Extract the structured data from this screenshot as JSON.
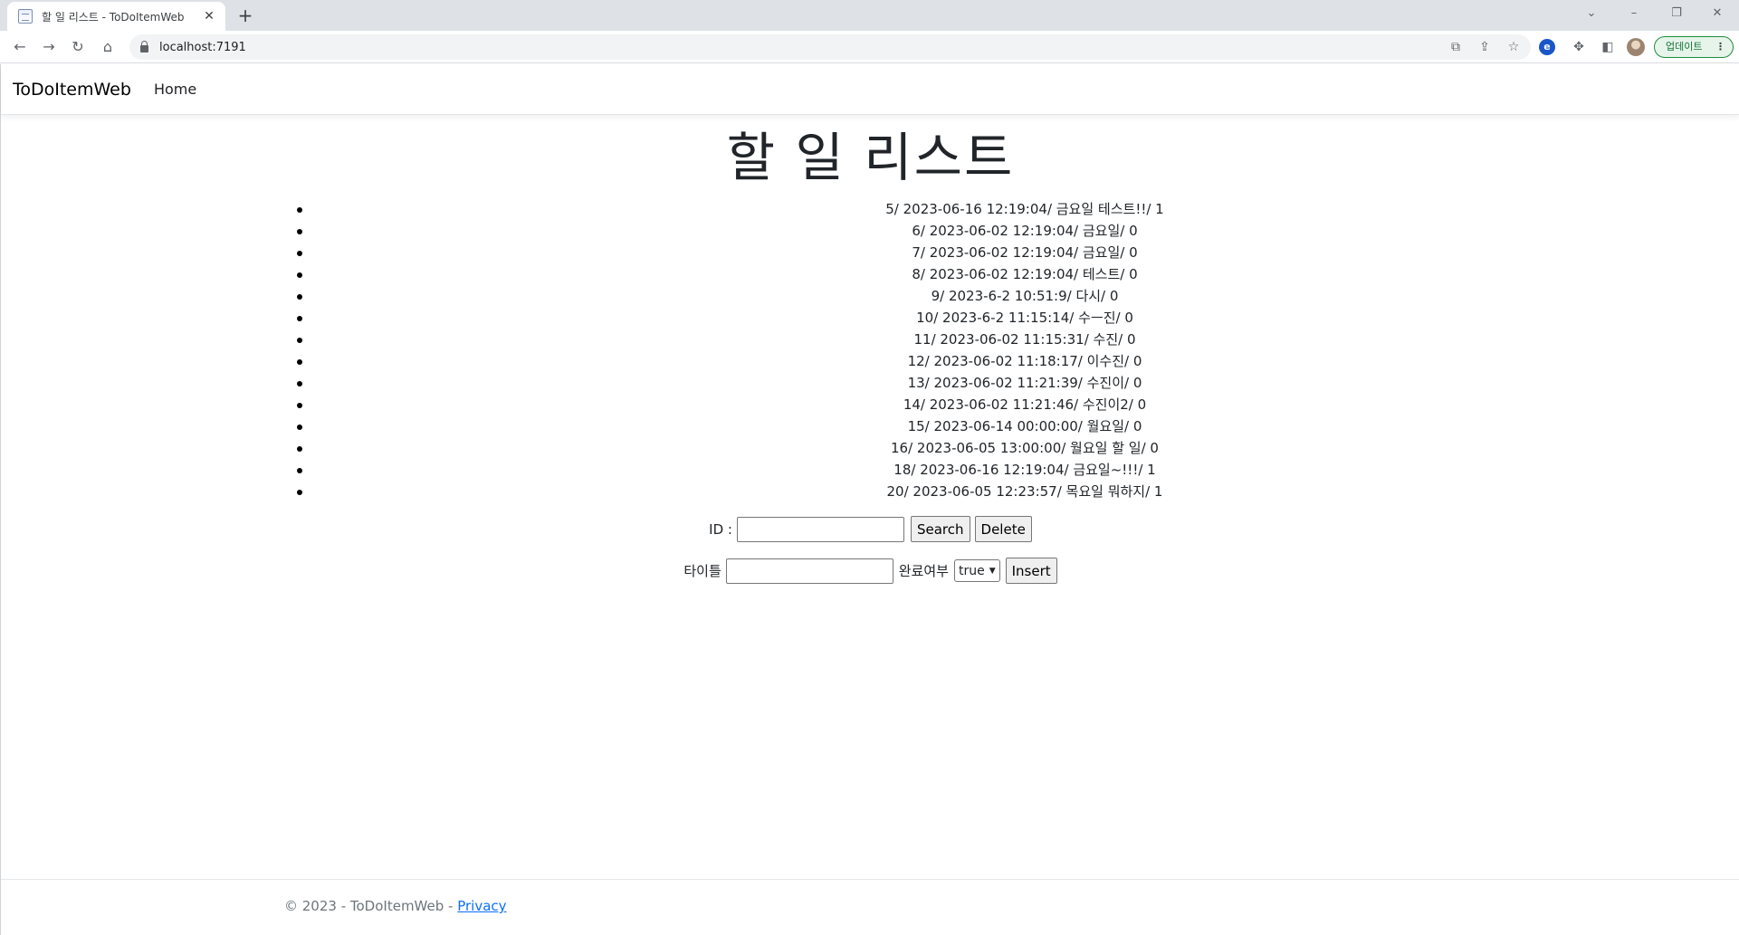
{
  "browser": {
    "tab_title": "할 일 리스트 - ToDoItemWeb",
    "url": "localhost:7191",
    "update_label": "업데이트"
  },
  "nav": {
    "brand": "ToDoItemWeb",
    "home": "Home"
  },
  "heading": "할 일 리스트",
  "todos": [
    "5/ 2023-06-16 12:19:04/ 금요일 테스트!!/ 1",
    "6/ 2023-06-02 12:19:04/ 금요일/ 0",
    "7/ 2023-06-02 12:19:04/ 금요일/ 0",
    "8/ 2023-06-02 12:19:04/ 테스트/ 0",
    "9/ 2023-6-2 10:51:9/ 다시/ 0",
    "10/ 2023-6-2 11:15:14/ 수ㅡ진/ 0",
    "11/ 2023-06-02 11:15:31/ 수진/ 0",
    "12/ 2023-06-02 11:18:17/ 이수진/ 0",
    "13/ 2023-06-02 11:21:39/ 수진이/ 0",
    "14/ 2023-06-02 11:21:46/ 수진이2/ 0",
    "15/ 2023-06-14 00:00:00/ 월요일/ 0",
    "16/ 2023-06-05 13:00:00/ 월요일 할 일/ 0",
    "18/ 2023-06-16 12:19:04/ 금요일~!!!/ 1",
    "20/ 2023-06-05 12:23:57/ 목요일 뭐하지/ 1"
  ],
  "search_form": {
    "id_label": "ID :",
    "id_value": "",
    "search_button": "Search",
    "delete_button": "Delete"
  },
  "insert_form": {
    "title_label": "타이틀",
    "title_value": "",
    "done_label": "완료여부",
    "done_selected": "true",
    "insert_button": "Insert"
  },
  "footer": {
    "copyright": "© 2023 - ToDoItemWeb - ",
    "privacy_link": "Privacy"
  }
}
